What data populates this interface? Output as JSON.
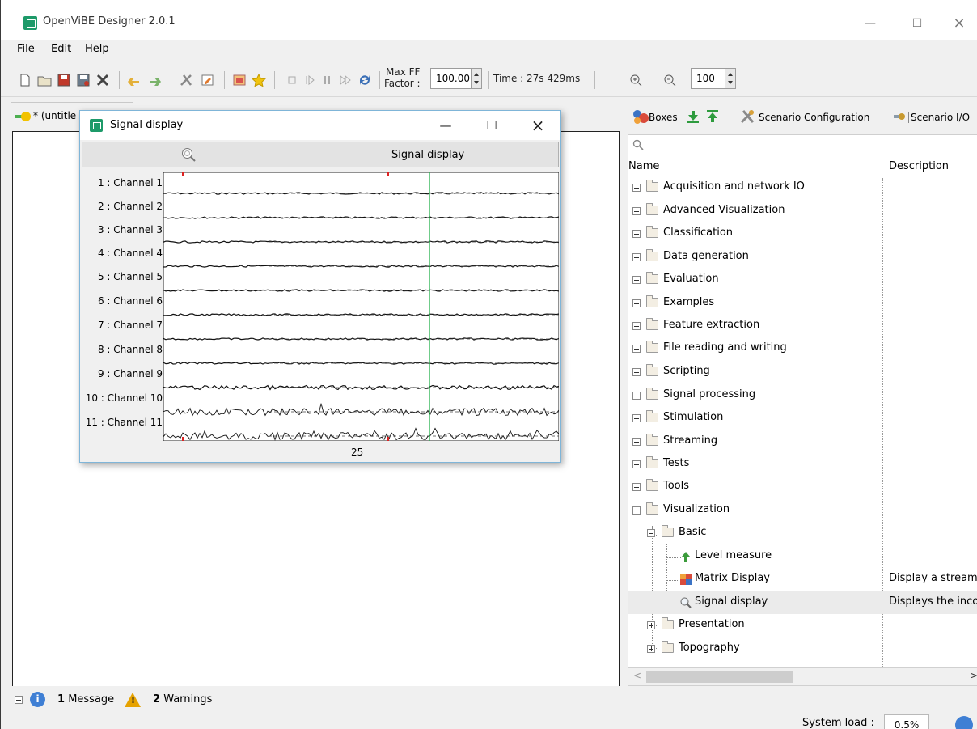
{
  "window": {
    "title": "OpenViBE Designer 2.0.1"
  },
  "menu": [
    {
      "key": "F",
      "rest": "ile"
    },
    {
      "key": "E",
      "rest": "dit"
    },
    {
      "key": "H",
      "rest": "elp"
    }
  ],
  "toolbar": {
    "maxff_line1": "Max FF",
    "maxff_line2": "Factor :",
    "maxff_value": "100.00",
    "time": "Time : 27s 429ms",
    "zoom_value": "100"
  },
  "scenario_tab": {
    "label": "* (untitle"
  },
  "signal_window": {
    "title": "Signal display",
    "toolbar_label": "Signal display",
    "channels": [
      "1 : Channel 1",
      "2 : Channel 2",
      "3 : Channel 3",
      "4 : Channel 4",
      "5 : Channel 5",
      "6 : Channel 6",
      "7 : Channel 7",
      "8 : Channel 8",
      "9 : Channel 9",
      "10 : Channel 10",
      "11 : Channel 11"
    ],
    "x_tick": "25"
  },
  "right_panel": {
    "tabs": {
      "boxes": "Boxes",
      "scenario_config": "Scenario Configuration",
      "scenario_io": "Scenario I/O"
    },
    "columns": {
      "name": "Name",
      "description": "Description"
    },
    "tree": [
      {
        "label": "Acquisition and network IO"
      },
      {
        "label": "Advanced Visualization"
      },
      {
        "label": "Classification"
      },
      {
        "label": "Data generation"
      },
      {
        "label": "Evaluation"
      },
      {
        "label": "Examples"
      },
      {
        "label": "Feature extraction"
      },
      {
        "label": "File reading and writing"
      },
      {
        "label": "Scripting"
      },
      {
        "label": "Signal processing"
      },
      {
        "label": "Stimulation"
      },
      {
        "label": "Streaming"
      },
      {
        "label": "Tests"
      },
      {
        "label": "Tools"
      },
      {
        "label": "Visualization"
      },
      {
        "label": "Basic"
      },
      {
        "label": "Level measure",
        "description": ""
      },
      {
        "label": "Matrix Display",
        "description": "Display a streame"
      },
      {
        "label": "Signal display",
        "description": "Displays the inco"
      },
      {
        "label": "Presentation"
      },
      {
        "label": "Topography"
      }
    ]
  },
  "status": {
    "messages_count": "1",
    "messages_label": "Message",
    "warnings_count": "2",
    "warnings_label": "Warnings",
    "system_load_label": "System load :",
    "system_load_value": "0.5%"
  }
}
